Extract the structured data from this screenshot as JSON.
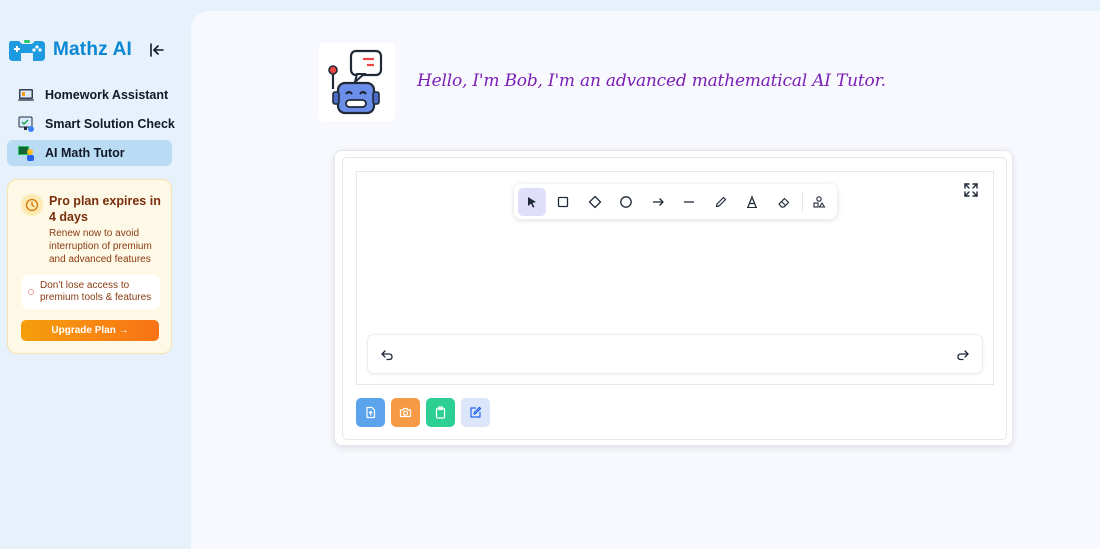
{
  "brand": {
    "name": "Mathz AI",
    "logo_icon": "gamepad-logo-icon"
  },
  "sidebar": {
    "collapse_icon": "collapse-sidebar-icon",
    "items": [
      {
        "label": "Homework Assistant",
        "icon": "laptop-book-icon",
        "active": false
      },
      {
        "label": "Smart Solution Check",
        "icon": "monitor-check-icon",
        "active": false
      },
      {
        "label": "AI Math Tutor",
        "icon": "tutor-board-icon",
        "active": true
      }
    ]
  },
  "promo": {
    "title": "Pro plan expires in 4 days",
    "description": "Renew now to avoid interruption of premium and advanced features",
    "note": "Don't lose access to premium tools & features",
    "button_label": "Upgrade Plan →",
    "accent_color": "#f97316"
  },
  "tutor": {
    "greeting": "Hello, I'm Bob, I'm an advanced mathematical AI Tutor.",
    "avatar_icon": "robot-avatar-icon"
  },
  "whiteboard": {
    "tools": [
      {
        "name": "select",
        "icon": "pointer-icon",
        "active": true
      },
      {
        "name": "rectangle",
        "icon": "rectangle-icon",
        "active": false
      },
      {
        "name": "diamond",
        "icon": "diamond-icon",
        "active": false
      },
      {
        "name": "ellipse",
        "icon": "circle-icon",
        "active": false
      },
      {
        "name": "arrow",
        "icon": "arrow-icon",
        "active": false
      },
      {
        "name": "line",
        "icon": "line-icon",
        "active": false
      },
      {
        "name": "draw",
        "icon": "pencil-icon",
        "active": false
      },
      {
        "name": "text",
        "icon": "text-icon",
        "active": false
      },
      {
        "name": "eraser",
        "icon": "eraser-icon",
        "active": false
      },
      {
        "name": "more-shapes",
        "icon": "shapes-icon",
        "active": false
      }
    ],
    "fullscreen_icon": "fullscreen-icon",
    "undo_icon": "undo-icon",
    "redo_icon": "redo-icon"
  },
  "actions": [
    {
      "name": "upload-document",
      "icon": "document-upload-icon",
      "color": "#5ba4ec"
    },
    {
      "name": "camera",
      "icon": "camera-icon",
      "color": "#f79a45"
    },
    {
      "name": "clipboard",
      "icon": "clipboard-icon",
      "color": "#2ecf93"
    },
    {
      "name": "edit",
      "icon": "edit-icon",
      "color": "#dbe6fb"
    }
  ],
  "colors": {
    "brand": "#0b87d4",
    "active_nav": "#b9dcf4",
    "greeting": "#7b1fb5"
  }
}
